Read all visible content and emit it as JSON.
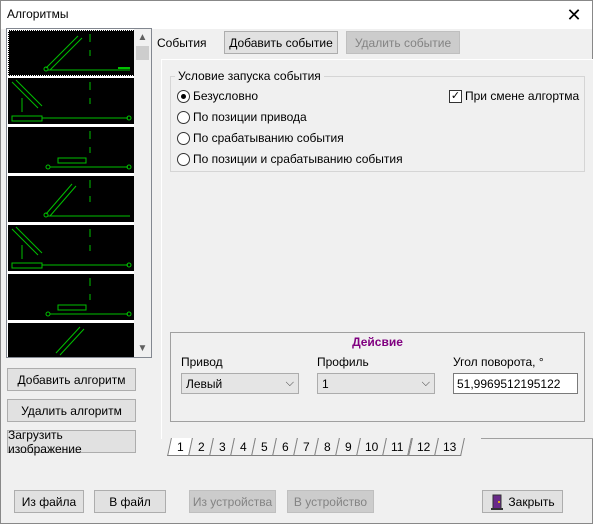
{
  "window": {
    "title": "Алгоритмы"
  },
  "left": {
    "add_algorithm": "Добавить алгоритм",
    "delete_algorithm": "Удалить алгоритм",
    "load_image": "Загрузить изображение"
  },
  "events": {
    "label": "События",
    "add_event": "Добавить событие",
    "delete_event": "Удалить событие"
  },
  "condition": {
    "legend": "Условие запуска события",
    "options": [
      "Безусловно",
      "По позиции привода",
      "По срабатыванию события",
      "По позиции и срабатыванию события"
    ],
    "selected_index": 0,
    "on_change_label": "При смене алгортма",
    "on_change_checked": true
  },
  "action": {
    "title": "Дейсвие",
    "drive_label": "Привод",
    "drive_value": "Левый",
    "profile_label": "Профиль",
    "profile_value": "1",
    "angle_label": "Угол поворота, °",
    "angle_value": "51,9969512195122"
  },
  "tabs": [
    "1",
    "2",
    "3",
    "4",
    "5",
    "6",
    "7",
    "8",
    "9",
    "10",
    "11",
    "12",
    "13"
  ],
  "active_tab": 0,
  "footer": {
    "from_file": "Из файла",
    "to_file": "В файл",
    "from_device": "Из устройства",
    "to_device": "В устройство",
    "close": "Закрыть"
  },
  "colors": {
    "thumb_line": "#00c000",
    "action_title": "#800080"
  }
}
